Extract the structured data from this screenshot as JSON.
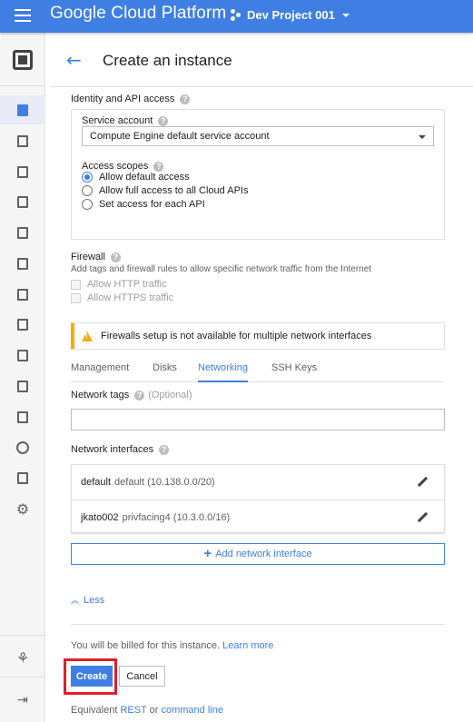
{
  "topbar": {
    "brand": "Google Cloud Platform",
    "project_name": "Dev Project 001",
    "colors": {
      "bar": "#3f7fe4",
      "text": "#ffffff"
    }
  },
  "rail": {
    "items": [
      {
        "icon": "compute-engine-chip-icon"
      },
      {
        "icon": "vm-instances-icon",
        "active": true
      },
      {
        "icon": "instance-groups-icon"
      },
      {
        "icon": "instance-templates-icon"
      },
      {
        "icon": "disks-icon"
      },
      {
        "icon": "snapshots-icon"
      },
      {
        "icon": "images-icon"
      },
      {
        "icon": "tpus-icon"
      },
      {
        "icon": "committed-use-discounts-icon"
      },
      {
        "icon": "metadata-icon"
      },
      {
        "icon": "health-checks-icon"
      },
      {
        "icon": "zones-icon"
      },
      {
        "icon": "operations-icon"
      },
      {
        "icon": "quotas-icon"
      },
      {
        "icon": "settings-icon"
      },
      {
        "icon": "marketplace-icon"
      },
      {
        "icon": "expand-rail-icon"
      }
    ]
  },
  "header": {
    "title": "Create an instance",
    "back_icon": "arrow-back-icon"
  },
  "identity": {
    "section_label": "Identity and API access",
    "service_account_label": "Service account",
    "service_account_value": "Compute Engine default service account",
    "access_scopes_label": "Access scopes",
    "scopes": [
      {
        "label": "Allow default access",
        "selected": true
      },
      {
        "label": "Allow full access to all Cloud APIs",
        "selected": false
      },
      {
        "label": "Set access for each API",
        "selected": false
      }
    ]
  },
  "firewall": {
    "label": "Firewall",
    "description": "Add tags and firewall rules to allow specific network traffic from the Internet",
    "options": [
      {
        "label": "Allow HTTP traffic",
        "checked": false,
        "disabled": true
      },
      {
        "label": "Allow HTTPS traffic",
        "checked": false,
        "disabled": true
      }
    ],
    "warning": "Firewalls setup is not available for multiple network interfaces"
  },
  "tabs": [
    {
      "label": "Management",
      "active": false
    },
    {
      "label": "Disks",
      "active": false
    },
    {
      "label": "Networking",
      "active": true
    },
    {
      "label": "SSH Keys",
      "active": false
    }
  ],
  "networking": {
    "tags_label": "Network tags",
    "tags_optional": "(Optional)",
    "tags_value": "",
    "interfaces_label": "Network interfaces",
    "interfaces": [
      {
        "name": "default",
        "detail": "default (10.138.0.0/20)"
      },
      {
        "name": "jkato002",
        "detail": "privfacing4 (10.3.0.0/16)"
      }
    ],
    "add_interface_label": "Add network interface"
  },
  "less_label": "Less",
  "billing": {
    "text": "You will be billed for this instance.",
    "learn_more": "Learn more"
  },
  "actions": {
    "create": "Create",
    "cancel": "Cancel",
    "highlight_color": "#e21e2a"
  },
  "equivalent": {
    "prefix": "Equivalent",
    "rest": "REST",
    "or": "or",
    "command_line": "command line"
  }
}
